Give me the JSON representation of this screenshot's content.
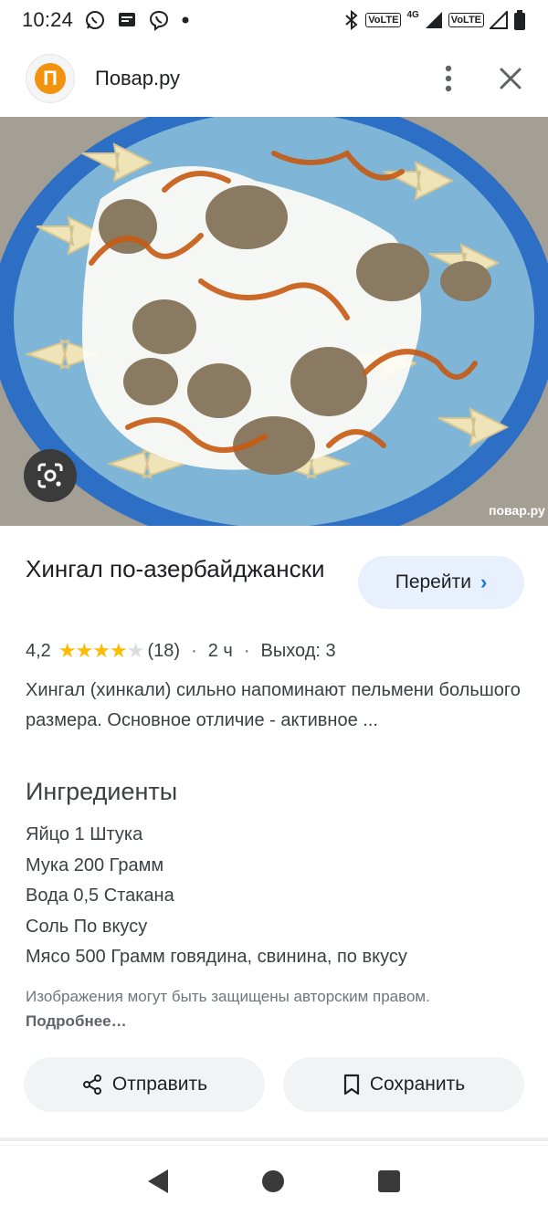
{
  "status_bar": {
    "time": "10:24",
    "volte1": "VoLTE",
    "net_type": "4G",
    "volte2": "VoLTE"
  },
  "header": {
    "site_logo_letter": "П",
    "site_name": "Повар.ру"
  },
  "hero": {
    "watermark": "повар.ру"
  },
  "recipe": {
    "title": "Хингал по-азербайджански",
    "go_button": "Перейти",
    "rating": "4,2",
    "stars_filled": 4,
    "stars_total": 5,
    "reviews": "(18)",
    "time": "2 ч",
    "yield": "Выход: 3",
    "description": "Хингал (хинкали) сильно напоминают пельмени большого размера. Основное отличие - активное ..."
  },
  "ingredients": {
    "title": "Ингредиенты",
    "items": [
      "Яйцо 1 Штука",
      "Мука 200 Грамм",
      "Вода 0,5 Стакана",
      "Соль По вкусу",
      "Мясо 500 Грамм говядина, свинина, по вкусу"
    ]
  },
  "copyright": {
    "text": "Изображения могут быть защищены авторским правом.",
    "link": "Подробнее…"
  },
  "actions": {
    "share": "Отправить",
    "save": "Сохранить"
  },
  "colors": {
    "accent_blue": "#1a73e8",
    "star_yellow": "#fbbc04",
    "logo_orange": "#f2930e",
    "pill_bg": "#f1f3f4",
    "go_bg": "#e8f0fe"
  },
  "icons": [
    "whatsapp-icon",
    "message-icon",
    "viber-icon",
    "bluetooth-icon",
    "signal-icon",
    "battery-icon",
    "more-vert-icon",
    "close-icon",
    "google-lens-icon",
    "share-icon",
    "bookmark-icon",
    "back-icon",
    "home-icon",
    "recents-icon"
  ]
}
